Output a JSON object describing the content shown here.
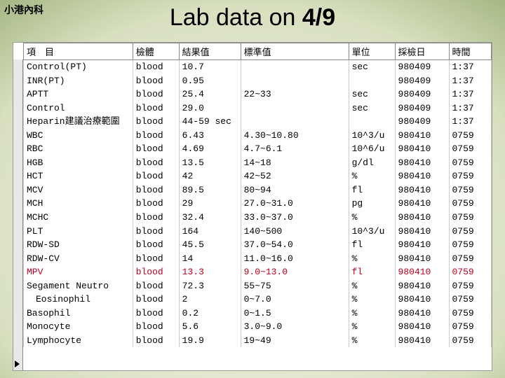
{
  "corner_label": "小港內科",
  "title_prefix": "Lab data on ",
  "title_date": "4/9",
  "headers": {
    "item": "項　目",
    "specimen": "檢體",
    "result": "結果值",
    "reference": "標準值",
    "unit": "單位",
    "date": "採檢日",
    "time": "時間"
  },
  "rows": [
    {
      "item": "Control(PT)",
      "spec": "blood",
      "result": "10.7",
      "ref": "",
      "unit": "sec",
      "date": "980409",
      "time": "1:37",
      "flag": false
    },
    {
      "item": "INR(PT)",
      "spec": "blood",
      "result": "0.95",
      "ref": "",
      "unit": "",
      "date": "980409",
      "time": "1:37",
      "flag": false
    },
    {
      "item": "APTT",
      "spec": "blood",
      "result": "25.4",
      "ref": "22~33",
      "unit": "sec",
      "date": "980409",
      "time": "1:37",
      "flag": false
    },
    {
      "item": "Control",
      "spec": "blood",
      "result": "29.0",
      "ref": "",
      "unit": "sec",
      "date": "980409",
      "time": "1:37",
      "flag": false
    },
    {
      "item": "Heparin建議治療範圍",
      "spec": "blood",
      "result": "44-59 sec",
      "ref": "",
      "unit": "",
      "date": "980409",
      "time": "1:37",
      "flag": false
    },
    {
      "item": "WBC",
      "spec": "blood",
      "result": "6.43",
      "ref": "4.30~10.80",
      "unit": "10^3/u",
      "date": "980410",
      "time": "0759",
      "flag": false
    },
    {
      "item": "RBC",
      "spec": "blood",
      "result": "4.69",
      "ref": "4.7~6.1",
      "unit": "10^6/u",
      "date": "980410",
      "time": "0759",
      "flag": false
    },
    {
      "item": "HGB",
      "spec": "blood",
      "result": "13.5",
      "ref": "14~18",
      "unit": "g/dl",
      "date": "980410",
      "time": "0759",
      "flag": false
    },
    {
      "item": "HCT",
      "spec": "blood",
      "result": "42",
      "ref": "42~52",
      "unit": "%",
      "date": "980410",
      "time": "0759",
      "flag": false
    },
    {
      "item": "MCV",
      "spec": "blood",
      "result": "89.5",
      "ref": "80~94",
      "unit": "fl",
      "date": "980410",
      "time": "0759",
      "flag": false
    },
    {
      "item": "MCH",
      "spec": "blood",
      "result": "29",
      "ref": "27.0~31.0",
      "unit": "pg",
      "date": "980410",
      "time": "0759",
      "flag": false
    },
    {
      "item": "MCHC",
      "spec": "blood",
      "result": "32.4",
      "ref": "33.0~37.0",
      "unit": "%",
      "date": "980410",
      "time": "0759",
      "flag": false
    },
    {
      "item": "PLT",
      "spec": "blood",
      "result": "164",
      "ref": "140~500",
      "unit": "10^3/u",
      "date": "980410",
      "time": "0759",
      "flag": false
    },
    {
      "item": "RDW-SD",
      "spec": "blood",
      "result": "45.5",
      "ref": "37.0~54.0",
      "unit": "fl",
      "date": "980410",
      "time": "0759",
      "flag": false
    },
    {
      "item": "RDW-CV",
      "spec": "blood",
      "result": "14",
      "ref": "11.0~16.0",
      "unit": "%",
      "date": "980410",
      "time": "0759",
      "flag": false
    },
    {
      "item": "MPV",
      "spec": "blood",
      "result": "13.3",
      "ref": "9.0~13.0",
      "unit": "fl",
      "date": "980410",
      "time": "0759",
      "flag": true
    },
    {
      "item": "Segament Neutro",
      "spec": "blood",
      "result": "72.3",
      "ref": "55~75",
      "unit": "%",
      "date": "980410",
      "time": "0759",
      "flag": false
    },
    {
      "item": "　Eosinophil",
      "spec": "blood",
      "result": "2",
      "ref": "0~7.0",
      "unit": "%",
      "date": "980410",
      "time": "0759",
      "flag": false
    },
    {
      "item": "Basophil",
      "spec": "blood",
      "result": "0.2",
      "ref": "0~1.5",
      "unit": "%",
      "date": "980410",
      "time": "0759",
      "flag": false
    },
    {
      "item": "Monocyte",
      "spec": "blood",
      "result": "5.6",
      "ref": "3.0~9.0",
      "unit": "%",
      "date": "980410",
      "time": "0759",
      "flag": false
    },
    {
      "item": "Lymphocyte",
      "spec": "blood",
      "result": "19.9",
      "ref": "19~49",
      "unit": "%",
      "date": "980410",
      "time": "0759",
      "flag": false
    }
  ]
}
